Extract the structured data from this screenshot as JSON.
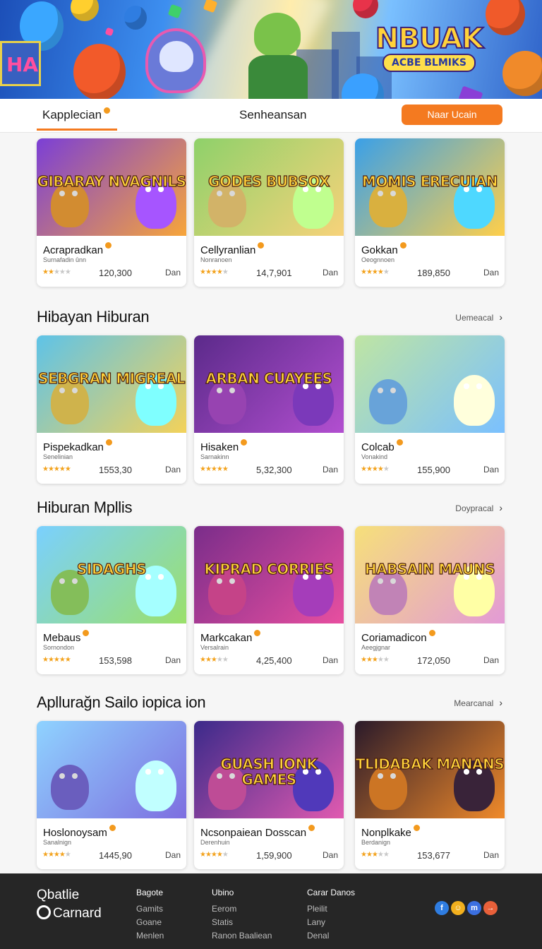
{
  "hero": {
    "logo_line1": "NBUAK",
    "logo_line2": "ACBE BLMIKS",
    "sign_text": "HA"
  },
  "nav": {
    "tab_active": "Kapplecian",
    "tab_center": "Senheansan",
    "cta": "Naar Ucain"
  },
  "sections": [
    {
      "title": "",
      "more": "",
      "cards": [
        {
          "thumb_title": "GIBARAY NVAGNILS",
          "name": "Acrapradkan",
          "sub": "Surnafadin ûnn",
          "stars": 2,
          "count": "120,300",
          "price": "Dan",
          "bg": "#7b3fd6",
          "bg2": "#f7a53a"
        },
        {
          "thumb_title": "GODES BUBSOX",
          "name": "Cellyranlian",
          "sub": "Nonranoen",
          "stars": 4,
          "count": "14,7,901",
          "price": "Dan",
          "bg": "#8ed16a",
          "bg2": "#f7d27a"
        },
        {
          "thumb_title": "MOMIS ERECUIAN",
          "name": "Gokkan",
          "sub": "Oeognnoen",
          "stars": 4,
          "count": "189,850",
          "price": "Dan",
          "bg": "#3aa0e8",
          "bg2": "#ffcf4a"
        }
      ]
    },
    {
      "title": "Hibayan Hiburan",
      "more": "Uemeacal",
      "cards": [
        {
          "thumb_title": "SEBGRAN MIGREAL",
          "name": "Pispekadkan",
          "sub": "Senelinian",
          "stars": 5,
          "count": "1553,30",
          "price": "Dan",
          "bg": "#5ec3e8",
          "bg2": "#f3d25a"
        },
        {
          "thumb_title": "ARBAN CUAYEES",
          "name": "Hisaken",
          "sub": "Sarnakinn",
          "stars": 5,
          "count": "5,32,300",
          "price": "Dan",
          "bg": "#5b2a8a",
          "bg2": "#b24fd0"
        },
        {
          "thumb_title": "",
          "name": "Colcab",
          "sub": "Vonakind",
          "stars": 4,
          "count": "155,900",
          "price": "Dan",
          "bg": "#bfe5a3",
          "bg2": "#7ac0ff"
        }
      ]
    },
    {
      "title": "Hiburan Mpllis",
      "more": "Doypracal",
      "cards": [
        {
          "thumb_title": "SIDAGHS",
          "name": "Mebaus",
          "sub": "Sornondon",
          "stars": 5,
          "count": "153,598",
          "price": "Dan",
          "bg": "#7ad0ff",
          "bg2": "#9be06a"
        },
        {
          "thumb_title": "KIPRAD CORRIES",
          "name": "Markcakan",
          "sub": "Versalrain",
          "stars": 3,
          "count": "4,25,400",
          "price": "Dan",
          "bg": "#7a2d8a",
          "bg2": "#e84fa0"
        },
        {
          "thumb_title": "HABSAIN MAUNS",
          "name": "Coriamadicon",
          "sub": "Aeegjgnar",
          "stars": 3,
          "count": "172,050",
          "price": "Dan",
          "bg": "#f6e07a",
          "bg2": "#e39ad6"
        }
      ]
    },
    {
      "title": "Apllurağn Sailo iopica ion",
      "more": "Mearcanal",
      "cards": [
        {
          "thumb_title": "",
          "name": "Hoslonoysam",
          "sub": "Sanalnign",
          "stars": 4,
          "count": "1445,90",
          "price": "Dan",
          "bg": "#8fd3ff",
          "bg2": "#7d6ee0"
        },
        {
          "thumb_title": "GUASH IONK GAMES",
          "name": "Ncsonpaiean Dosscan",
          "sub": "Derenhuin",
          "stars": 4,
          "count": "1,59,900",
          "price": "Dan",
          "bg": "#3b2a8a",
          "bg2": "#e05ab0"
        },
        {
          "thumb_title": "TLIDABAK MANANS",
          "name": "Nonplkake",
          "sub": "Berdanign",
          "stars": 3,
          "count": "153,677",
          "price": "Dan",
          "bg": "#2a1a2a",
          "bg2": "#f08a2a"
        }
      ]
    }
  ],
  "footer": {
    "brand_line1": "Qbatlie",
    "brand_line2": "Carnard",
    "columns": [
      {
        "heading": "Bagote",
        "items": [
          "Gamits",
          "Goane",
          "Menlen"
        ]
      },
      {
        "heading": "Ubino",
        "items": [
          "Eerom",
          "Statis",
          "Ranon Baaliean"
        ]
      },
      {
        "heading": "Carar Danos",
        "items": [
          "Pleilit",
          "Lany",
          "Denal"
        ]
      }
    ],
    "social": [
      {
        "icon": "facebook-icon",
        "glyph": "f",
        "color": "#2f7de1"
      },
      {
        "icon": "chat-icon",
        "glyph": "☺",
        "color": "#f2b01e"
      },
      {
        "icon": "messenger-icon",
        "glyph": "m",
        "color": "#3b6fe0"
      },
      {
        "icon": "share-icon",
        "glyph": "→",
        "color": "#e8603a"
      }
    ]
  }
}
